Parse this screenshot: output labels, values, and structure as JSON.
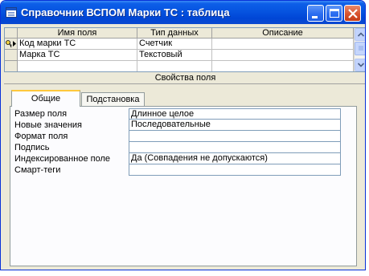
{
  "window": {
    "title": "Справочник ВСПОМ Марки ТС : таблица",
    "buttons": [
      "minimize",
      "maximize",
      "close"
    ]
  },
  "grid": {
    "columns": [
      "Имя поля",
      "Тип данных",
      "Описание"
    ],
    "rows": [
      {
        "name": "Код марки ТС",
        "type": "Счетчик",
        "description": "",
        "primary_key": true,
        "current": true
      },
      {
        "name": "Марка ТС",
        "type": "Текстовый",
        "description": "",
        "primary_key": false,
        "current": false
      },
      {
        "name": "",
        "type": "",
        "description": "",
        "primary_key": false,
        "current": false
      }
    ]
  },
  "properties": {
    "header": "Свойства поля",
    "tabs": [
      {
        "label": "Общие",
        "active": true
      },
      {
        "label": "Подстановка",
        "active": false
      }
    ],
    "items": [
      {
        "label": "Размер поля",
        "value": "Длинное целое"
      },
      {
        "label": "Новые значения",
        "value": "Последовательные"
      },
      {
        "label": "Формат поля",
        "value": ""
      },
      {
        "label": "Подпись",
        "value": ""
      },
      {
        "label": "Индексированное поле",
        "value": "Да (Совпадения не допускаются)"
      },
      {
        "label": "Смарт-теги",
        "value": ""
      }
    ]
  },
  "colors": {
    "titlebar": "#0054e3",
    "window_bg": "#ece9d8",
    "active_tab_accent": "#ffc83c",
    "selection": "#000000"
  },
  "icons": [
    "table-icon",
    "minimize-icon",
    "maximize-icon",
    "close-icon",
    "primary-key-icon",
    "current-record-icon",
    "scroll-up-icon",
    "scroll-down-icon"
  ]
}
